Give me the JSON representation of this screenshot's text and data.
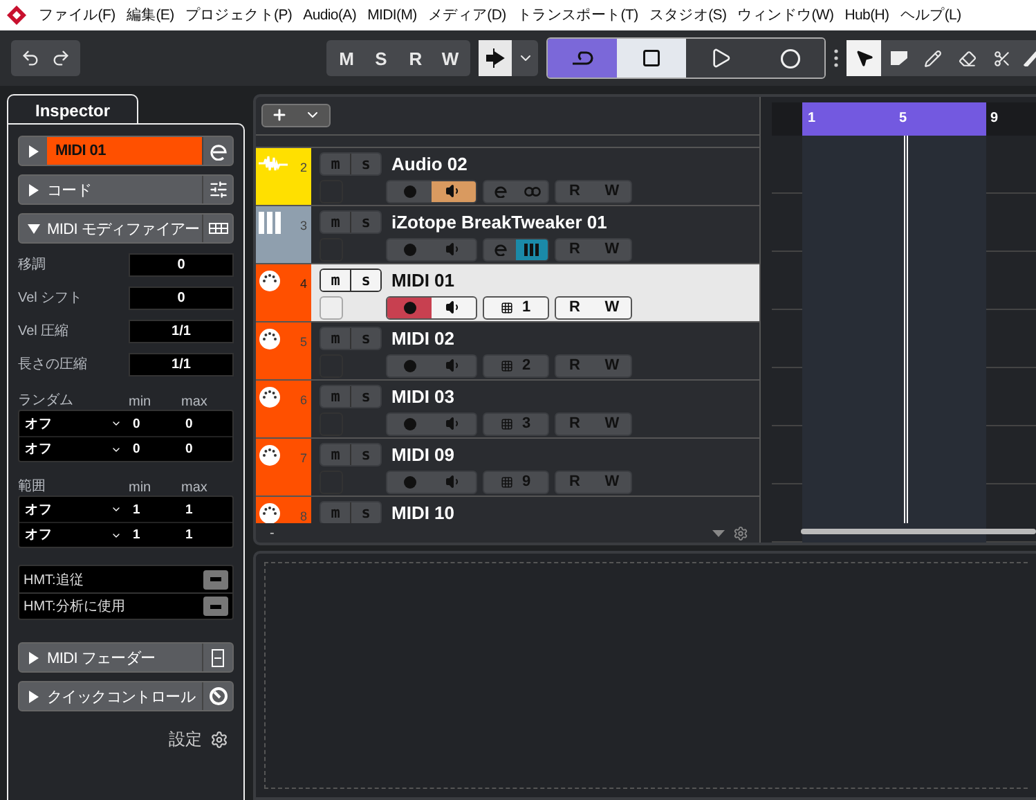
{
  "menu": [
    "ファイル(F)",
    "編集(E)",
    "プロジェクト(P)",
    "Audio(A)",
    "MIDI(M)",
    "メディア(D)",
    "トランスポート(T)",
    "スタジオ(S)",
    "ウィンドウ(W)",
    "Hub(H)",
    "ヘルプ(L)"
  ],
  "toolbar": {
    "states": [
      "M",
      "S",
      "R",
      "W"
    ],
    "transport": [
      {
        "kind": "cycle",
        "selected": true
      },
      {
        "kind": "stop",
        "selected": false
      },
      {
        "kind": "play",
        "selected": false
      },
      {
        "kind": "record",
        "selected": false
      }
    ]
  },
  "inspector": {
    "tab": "Inspector",
    "sections": [
      {
        "kind": "track",
        "label": "MIDI 01",
        "expanded": false
      },
      {
        "kind": "chord",
        "label": "コード",
        "expanded": false
      },
      {
        "kind": "modifier",
        "label": "MIDI モディファイアー",
        "expanded": true
      },
      {
        "kind": "fader",
        "label": "MIDI フェーダー",
        "expanded": false
      },
      {
        "kind": "quick",
        "label": "クイックコントロール",
        "expanded": false
      }
    ],
    "modifier": {
      "fields": [
        {
          "label": "移調",
          "value": "0"
        },
        {
          "label": "Vel シフト",
          "value": "0"
        },
        {
          "label": "Vel 圧縮",
          "value": "1/1"
        },
        {
          "label": "長さの圧縮",
          "value": "1/1"
        }
      ],
      "groups": [
        {
          "title": "ランダム",
          "min": "min",
          "max": "max",
          "rows": [
            {
              "mode": "オフ",
              "min": "0",
              "max": "0"
            },
            {
              "mode": "オフ",
              "min": "0",
              "max": "0"
            }
          ]
        },
        {
          "title": "範囲",
          "min": "min",
          "max": "max",
          "rows": [
            {
              "mode": "オフ",
              "min": "1",
              "max": "1"
            },
            {
              "mode": "オフ",
              "min": "1",
              "max": "1"
            }
          ]
        }
      ],
      "hmt": [
        "HMT:追従",
        "HMT:分析に使用"
      ]
    },
    "settings": "設定"
  },
  "tracks": [
    {
      "number": "2",
      "name": "Audio 02",
      "kind": "audio",
      "color": "#ffe000",
      "selected": false,
      "mute": "m",
      "solo": "s",
      "record": false,
      "monitor": true,
      "read": "R",
      "write": "W"
    },
    {
      "number": "3",
      "name": "iZotope BreakTweaker 01",
      "kind": "instrument",
      "color": "#8f9fae",
      "selected": false,
      "mute": "m",
      "solo": "s",
      "record": false,
      "monitor": false,
      "instrument_on": true,
      "read": "R",
      "write": "W"
    },
    {
      "number": "4",
      "name": "MIDI 01",
      "kind": "midi",
      "color": "#ff5000",
      "selected": true,
      "mute": "m",
      "solo": "s",
      "record": true,
      "monitor": false,
      "channel": "1",
      "read": "R",
      "write": "W"
    },
    {
      "number": "5",
      "name": "MIDI 02",
      "kind": "midi",
      "color": "#ff5000",
      "selected": false,
      "mute": "m",
      "solo": "s",
      "record": false,
      "monitor": false,
      "channel": "2",
      "read": "R",
      "write": "W"
    },
    {
      "number": "6",
      "name": "MIDI 03",
      "kind": "midi",
      "color": "#ff5000",
      "selected": false,
      "mute": "m",
      "solo": "s",
      "record": false,
      "monitor": false,
      "channel": "3",
      "read": "R",
      "write": "W"
    },
    {
      "number": "7",
      "name": "MIDI 09",
      "kind": "midi",
      "color": "#ff5000",
      "selected": false,
      "mute": "m",
      "solo": "s",
      "record": false,
      "monitor": false,
      "channel": "9",
      "read": "R",
      "write": "W"
    },
    {
      "number": "8",
      "name": "MIDI 10",
      "kind": "midi",
      "color": "#ff5000",
      "selected": false,
      "mute": "m",
      "solo": "s"
    }
  ],
  "track_list_footer": "-",
  "ruler": [
    "1",
    "5",
    "9"
  ]
}
